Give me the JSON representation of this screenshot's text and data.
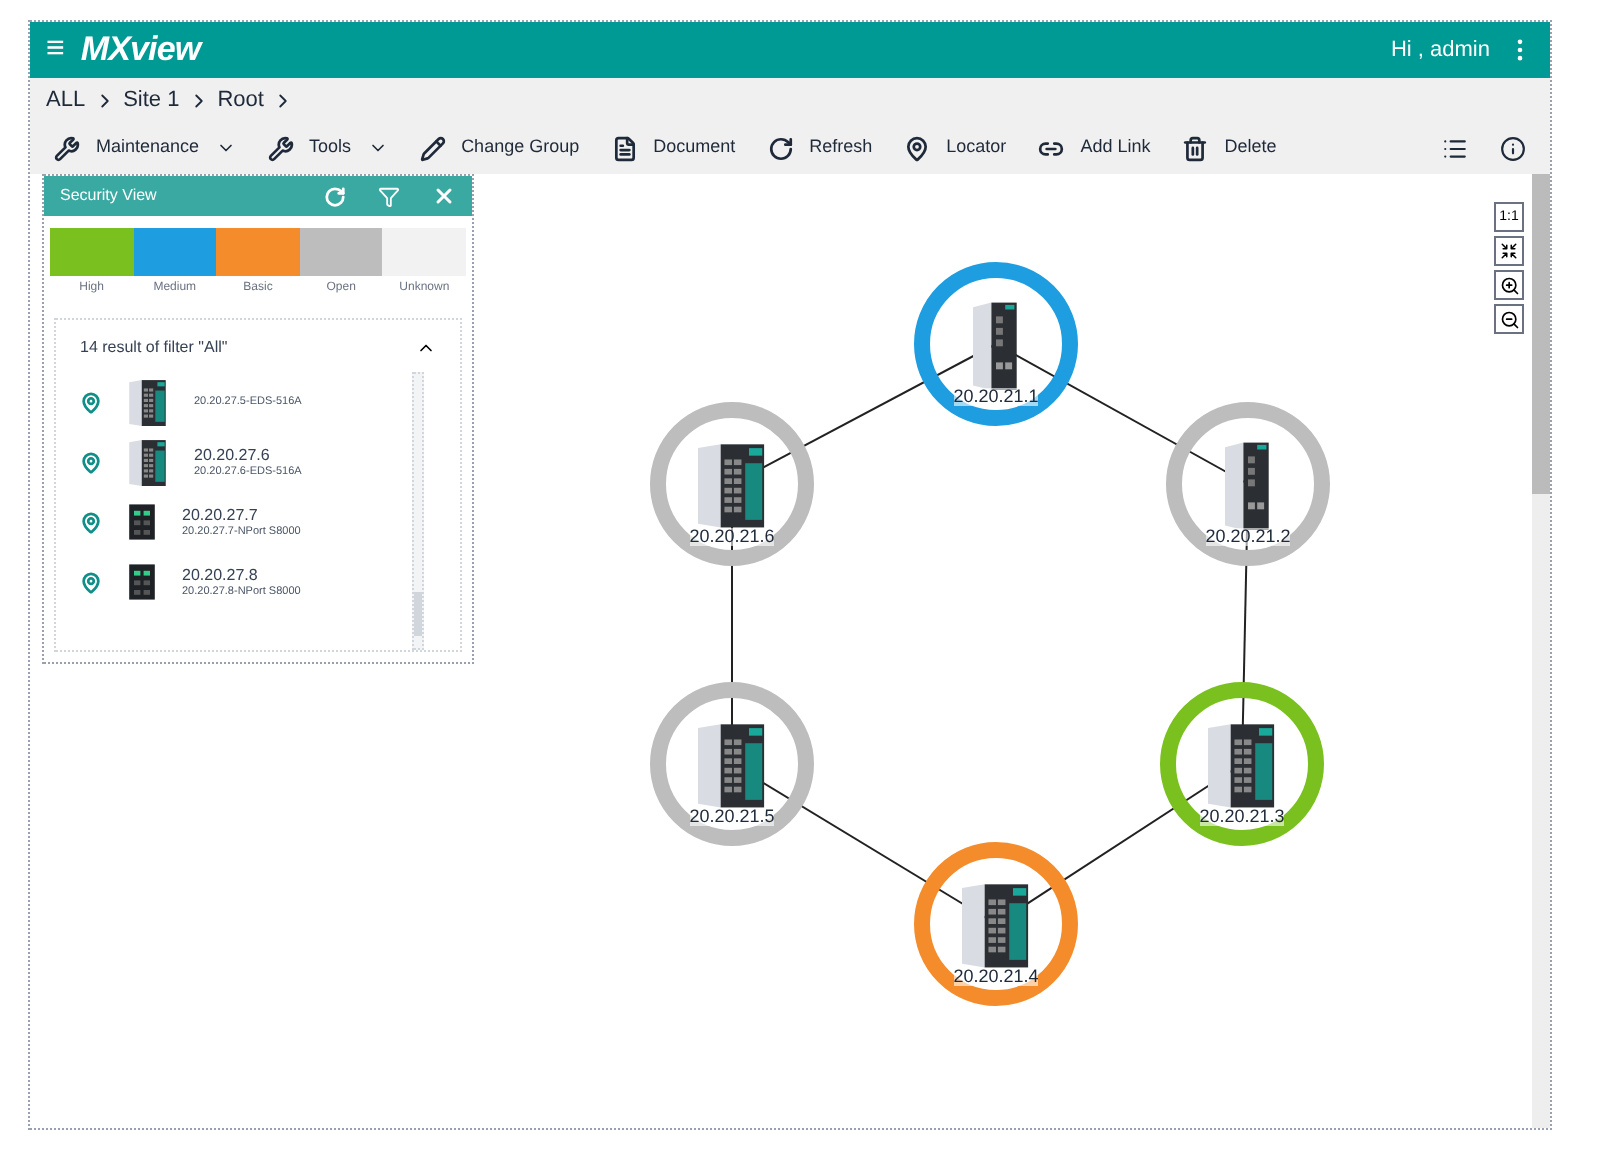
{
  "header": {
    "menu_icon": "≡",
    "logo": "MXview",
    "user": "Hi , admin"
  },
  "breadcrumb": [
    "ALL",
    "Site 1",
    "Root"
  ],
  "toolbar": [
    {
      "kind": "wrench",
      "label": "Maintenance",
      "dropdown": true
    },
    {
      "kind": "wrench",
      "label": "Tools",
      "dropdown": true
    },
    {
      "kind": "pencil",
      "label": "Change Group",
      "dropdown": false
    },
    {
      "kind": "document",
      "label": "Document",
      "dropdown": false
    },
    {
      "kind": "refresh",
      "label": "Refresh",
      "dropdown": false
    },
    {
      "kind": "pin",
      "label": "Locator",
      "dropdown": false
    },
    {
      "kind": "link",
      "label": "Add Link",
      "dropdown": false
    },
    {
      "kind": "trash",
      "label": "Delete",
      "dropdown": false
    }
  ],
  "security_panel": {
    "title": "Security View",
    "legend": [
      {
        "label": "High",
        "color": "#7ac11f"
      },
      {
        "label": "Medium",
        "color": "#1e9ee0"
      },
      {
        "label": "Basic",
        "color": "#f58c2c"
      },
      {
        "label": "Open",
        "color": "#bdbdbd"
      },
      {
        "label": "Unknown",
        "color": "#f2f2f2"
      }
    ],
    "result_title": "14 result of filter \"All\"",
    "expanded": true,
    "devices": [
      {
        "detail": "20.20.27.5-EDS-516A",
        "kind": "switch"
      },
      {
        "name": "20.20.27.6",
        "detail": "20.20.27.6-EDS-516A",
        "kind": "switch"
      },
      {
        "name": "20.20.27.7",
        "detail": "20.20.27.7-NPort S8000",
        "kind": "server"
      },
      {
        "name": "20.20.27.8",
        "detail": "20.20.27.8-NPort S8000",
        "kind": "server"
      }
    ]
  },
  "zoom_controls": {
    "actual_size": "1:1"
  },
  "topology": {
    "nodes": [
      {
        "label": "20.20.21.1",
        "color": "#1e9ee0",
        "kind": "slim"
      },
      {
        "label": "20.20.21.2",
        "color": "#bdbdbd",
        "kind": "slim"
      },
      {
        "label": "20.20.21.3",
        "color": "#7ac11f",
        "kind": "wide"
      },
      {
        "label": "20.20.21.4",
        "color": "#f58c2c",
        "kind": "wide"
      },
      {
        "label": "20.20.21.5",
        "color": "#bdbdbd",
        "kind": "wide"
      },
      {
        "label": "20.20.21.6",
        "color": "#bdbdbd",
        "kind": "wide"
      }
    ]
  }
}
